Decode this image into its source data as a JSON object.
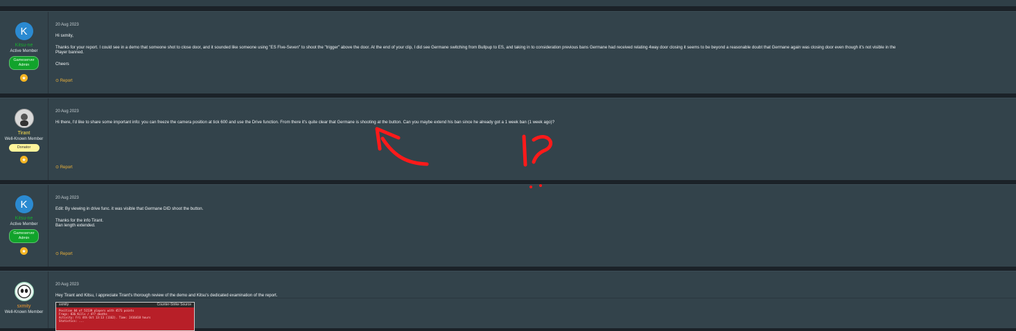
{
  "colors": {
    "page_bg": "#1b2228",
    "post_bg": "#33434b",
    "accent_report": "#f0b43a",
    "staff_banner": "#11a32b",
    "donator_banner": "#fff59b",
    "annotation": "#ff1a1a"
  },
  "posts": [
    {
      "user": {
        "avatar_letter": "K",
        "name": "Kitsu-ne",
        "name_color": "#18b02f",
        "title": "Active Member",
        "banner": "Gameserver Admin"
      },
      "date": "20 Aug 2023",
      "paragraphs": [
        "Hi sxmity,",
        "Thanks for your report. I could see in a demo that someone shot to close door, and it sounded like someone using \"ES Five-Seven\" to shoot the \"trigger\" above the door. At the end of your clip, I did see Germane switching from Bullpup to ES, and taking in to consideration previous bans Germane had received relating 4way door closing it seems to be beyond a reasonable doubt that Germane again was closing door even though it's not visible in the\nPlayer banned.",
        "Cheers"
      ],
      "report_label": "Report"
    },
    {
      "user": {
        "name": "Tirant",
        "name_color": "#ffe14d",
        "title": "Well-Known Member",
        "banner": "Donator"
      },
      "date": "20 Aug 2023",
      "paragraphs": [
        "Hi there, I'd like to share some important info: you can freeze the camera position at tick 600 and use the Drive function. From there it's quite clear that Germane is shooting at the button. Can you maybe extend his ban since he already got a 1 week ban (1 week ago)?"
      ],
      "report_label": "Report"
    },
    {
      "user": {
        "avatar_letter": "K",
        "name": "Kitsu-ne",
        "name_color": "#18b02f",
        "title": "Active Member",
        "banner": "Gameserver Admin"
      },
      "date": "20 Aug 2023",
      "paragraphs": [
        "Edit: By viewing in drive func. it was visible that Germane DID shoot the button.",
        "Thanks for the info Tirant.\nBan length extended."
      ],
      "report_label": "Report"
    },
    {
      "user": {
        "name": "sxmity",
        "name_color": "#f29a2e",
        "title": "Well-Known Member"
      },
      "date": "20 Aug 2023",
      "paragraphs": [
        "Hey Tirant and Kitsu, I appreciate Tirant's thorough review of the demo and Kitsu's dedicated examination of the report."
      ],
      "thumbnail": {
        "player": "sxmity",
        "game": "Counter-Strike Source",
        "lines": [
          "Position 84 of 51539 players with 4571 points",
          "Frags: 836 Kills / 4?? deaths",
          "Activity: Fri 4th Oct 13:13 (1162). Time: 2416418 hours",
          "Statistics: ..."
        ]
      }
    }
  ],
  "annotations": {
    "handwriting": "!?"
  }
}
